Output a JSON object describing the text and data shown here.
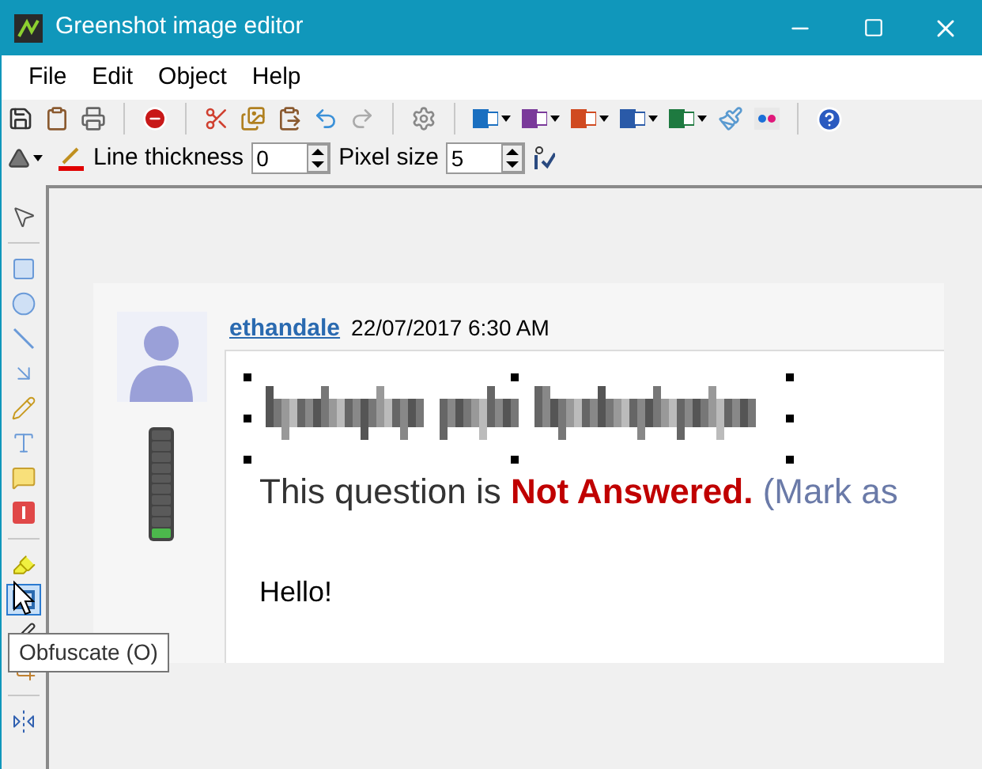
{
  "window": {
    "title": "Greenshot image editor"
  },
  "menu": [
    "File",
    "Edit",
    "Object",
    "Help"
  ],
  "settings": {
    "line_thickness": {
      "label": "Line thickness",
      "value": "0"
    },
    "pixel_size": {
      "label": "Pixel size",
      "value": "5"
    }
  },
  "tools": [
    {
      "kind": "pointer",
      "selected": false
    },
    {
      "kind": "separator"
    },
    {
      "kind": "rectangle",
      "selected": false
    },
    {
      "kind": "ellipse",
      "selected": false
    },
    {
      "kind": "line",
      "selected": false
    },
    {
      "kind": "arrow",
      "selected": false
    },
    {
      "kind": "freehand",
      "selected": false
    },
    {
      "kind": "text",
      "selected": false
    },
    {
      "kind": "speechbubble",
      "selected": false
    },
    {
      "kind": "counter",
      "selected": false
    },
    {
      "kind": "separator"
    },
    {
      "kind": "highlight",
      "selected": false
    },
    {
      "kind": "obfuscate",
      "selected": true
    },
    {
      "kind": "drop",
      "selected": false
    },
    {
      "kind": "crop",
      "selected": false
    },
    {
      "kind": "separator"
    },
    {
      "kind": "rotate",
      "selected": false
    }
  ],
  "tooltip": "Obfuscate (O)",
  "post": {
    "author": "ethandale",
    "date": "22/07/2017 6:30 AM",
    "rank_meter": {
      "level": 0.1
    },
    "status_prefix": "This question is",
    "status_value": "Not Answered.",
    "status_suffix": "(Mark as",
    "body": "Hello!"
  }
}
